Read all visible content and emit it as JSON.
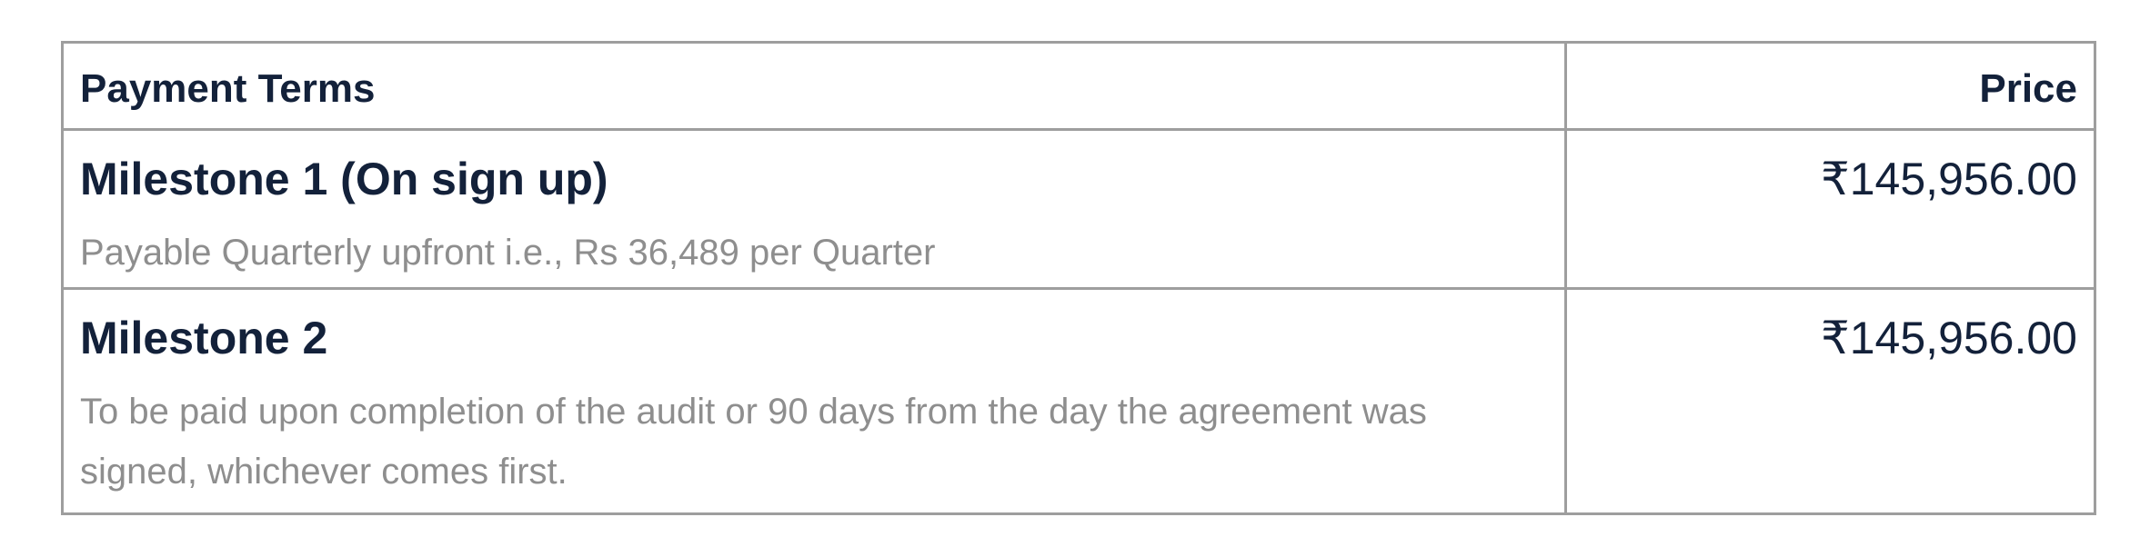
{
  "table": {
    "header": {
      "terms": "Payment Terms",
      "price": "Price"
    },
    "rows": [
      {
        "title": "Milestone 1 (On sign up)",
        "description": "Payable Quarterly upfront i.e., Rs 36,489 per Quarter",
        "price": "₹145,956.00"
      },
      {
        "title": "Milestone 2",
        "description": "To be paid upon completion of the audit or 90 days from the day the agreement was signed, whichever comes first.",
        "price": "₹145,956.00"
      }
    ]
  }
}
